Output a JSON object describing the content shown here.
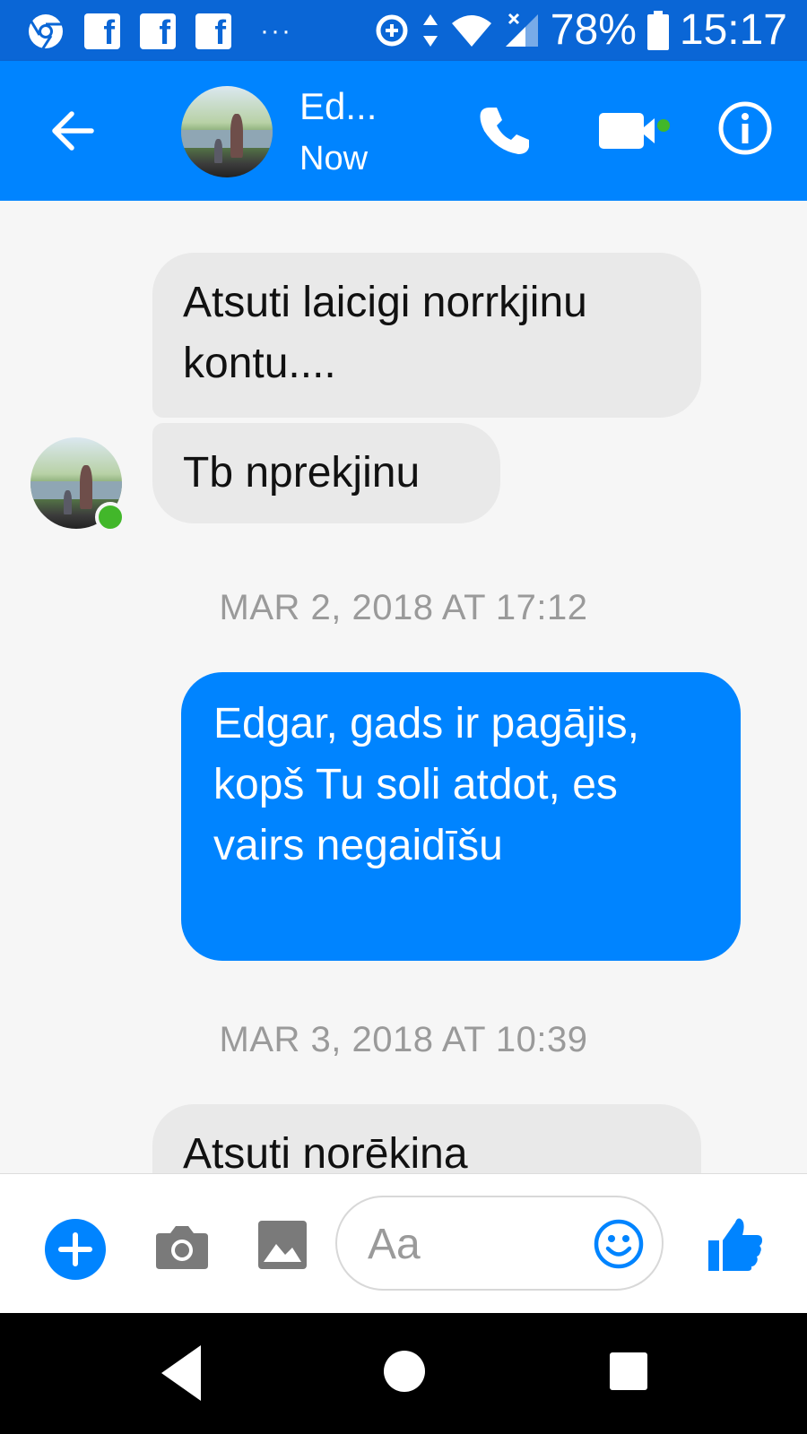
{
  "status_bar": {
    "battery": "78%",
    "time": "15:17",
    "icons": [
      "chrome-icon",
      "facebook-icon",
      "facebook-icon",
      "facebook-icon",
      "more-dots",
      "data-saver-icon",
      "data-arrows-icon",
      "wifi-icon",
      "signal-icon",
      "battery-icon"
    ],
    "more": "···"
  },
  "header": {
    "contact_name": "Ed...",
    "presence": "Now",
    "icons": [
      "back-arrow-icon",
      "phone-icon",
      "video-camera-icon",
      "info-icon"
    ],
    "accent_color": "#0084ff"
  },
  "thread": {
    "messages": [
      {
        "direction": "received",
        "text": "Atsuti laicigi norrkjinu kontu...."
      },
      {
        "direction": "received",
        "text": "Tb nprekjinu"
      },
      {
        "direction": "sent",
        "text": "Edgar, gads ir pagājis, kopš Tu soli atdot, es vairs negaidīšu"
      },
      {
        "direction": "received",
        "text": "Atsuti norēkina"
      }
    ],
    "timestamps": [
      "MAR 2, 2018 AT 17:12",
      "MAR 3, 2018 AT 10:39"
    ],
    "online_color": "#42b72a"
  },
  "composer": {
    "placeholder": "Aa",
    "icons": [
      "plus-icon",
      "camera-icon",
      "gallery-icon",
      "emoji-icon",
      "thumbs-up-icon"
    ]
  },
  "nav_bar": {
    "icons": [
      "nav-back-icon",
      "nav-home-icon",
      "nav-recents-icon"
    ]
  }
}
